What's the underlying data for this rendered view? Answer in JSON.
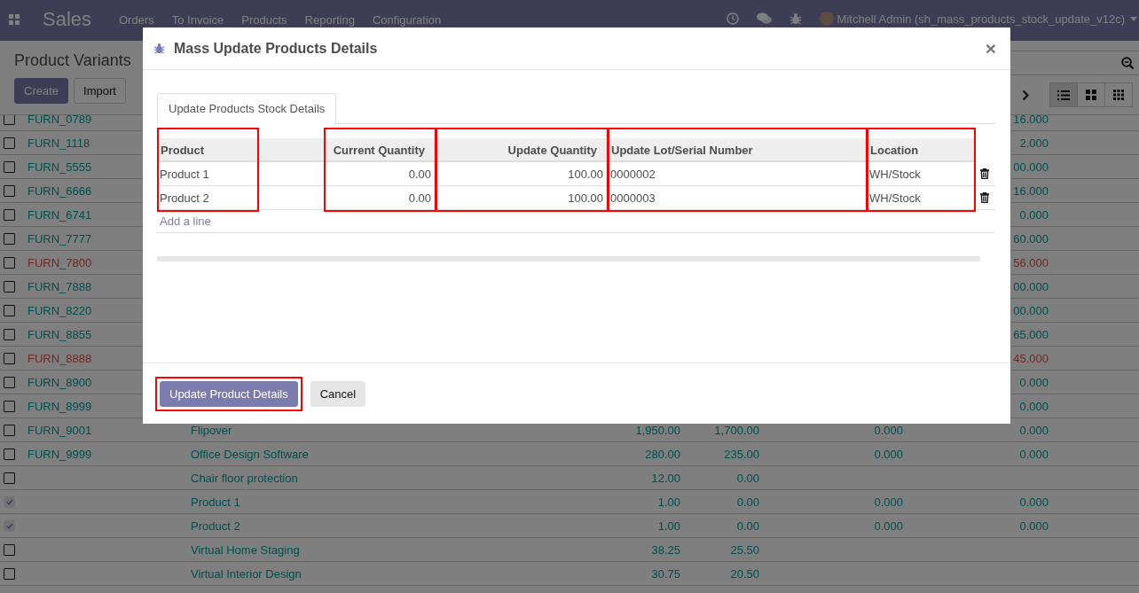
{
  "navbar": {
    "app_name": "Sales",
    "menu": [
      "Orders",
      "To Invoice",
      "Products",
      "Reporting",
      "Configuration"
    ],
    "user": "Mitchell Admin (sh_mass_products_stock_update_v12c)"
  },
  "control_panel": {
    "title": "Product Variants",
    "buttons": [
      {
        "label": "Create",
        "kind": "primary"
      },
      {
        "label": "Import",
        "kind": "secondary"
      }
    ],
    "views": [
      {
        "kind": "list",
        "selected": true
      },
      {
        "kind": "kanban",
        "selected": false
      },
      {
        "kind": "grid",
        "selected": false
      }
    ]
  },
  "list_rows": [
    {
      "checked": false,
      "warning": false,
      "column_1": "FURN_0789",
      "column_6": "16.000"
    },
    {
      "checked": false,
      "warning": false,
      "column_1": "FURN_1118",
      "column_6": "2.000"
    },
    {
      "checked": false,
      "warning": false,
      "column_1": "FURN_5555",
      "column_6": "00.000"
    },
    {
      "checked": false,
      "warning": false,
      "column_1": "FURN_6666",
      "column_6": "16.000"
    },
    {
      "checked": false,
      "warning": false,
      "column_1": "FURN_6741",
      "column_6": "0.000"
    },
    {
      "checked": false,
      "warning": false,
      "column_1": "FURN_7777",
      "column_6": "60.000"
    },
    {
      "checked": false,
      "warning": true,
      "column_1": "FURN_7800",
      "column_6": "56.000"
    },
    {
      "checked": false,
      "warning": false,
      "column_1": "FURN_7888",
      "column_6": "00.000"
    },
    {
      "checked": false,
      "warning": false,
      "column_1": "FURN_8220",
      "column_6": "00.000"
    },
    {
      "checked": false,
      "warning": false,
      "column_1": "FURN_8855",
      "column_6": "65.000"
    },
    {
      "checked": false,
      "warning": true,
      "column_1": "FURN_8888",
      "column_6": "45.000"
    },
    {
      "checked": false,
      "warning": false,
      "column_1": "FURN_8900",
      "column_6": "0.000"
    },
    {
      "checked": false,
      "warning": false,
      "column_1": "FURN_8999",
      "column_6": "0.000"
    },
    {
      "checked": false,
      "warning": false,
      "column_1": "FURN_9001",
      "column_2": "Flipover",
      "column_3": "1,950.00",
      "column_4": "1,700.00",
      "column_5": "0.000",
      "column_6": "0.000"
    },
    {
      "checked": false,
      "warning": false,
      "column_1": "FURN_9999",
      "column_2": "Office Design Software",
      "column_3": "280.00",
      "column_4": "235.00",
      "column_5": "0.000",
      "column_6": "0.000"
    },
    {
      "checked": false,
      "warning": false,
      "column_2": "Chair floor protection",
      "column_3": "12.00",
      "column_4": "0.00"
    },
    {
      "checked": true,
      "warning": false,
      "column_2": "Product 1",
      "column_3": "1.00",
      "column_4": "0.00",
      "column_5": "0.000",
      "column_6": "0.000"
    },
    {
      "checked": true,
      "warning": false,
      "column_2": "Product 2",
      "column_3": "1.00",
      "column_4": "0.00",
      "column_5": "0.000",
      "column_6": "0.000"
    },
    {
      "checked": false,
      "warning": false,
      "column_2": "Virtual Home Staging",
      "column_3": "38.25",
      "column_4": "25.50"
    },
    {
      "checked": false,
      "warning": false,
      "column_2": "Virtual Interior Design",
      "column_3": "30.75",
      "column_4": "20.50"
    }
  ],
  "dialog": {
    "title": "Mass Update Products Details",
    "close": "×",
    "tabs": [
      {
        "label": "Update Products Stock Details",
        "selected": true
      }
    ],
    "table": {
      "columns": [
        {
          "label": "Product",
          "kind": "text",
          "highlighted": true
        },
        {
          "label": "Current Quantity",
          "kind": "number",
          "highlighted": true
        },
        {
          "label": "Update Quantity",
          "kind": "number",
          "highlighted": true
        },
        {
          "label": "Update Lot/Serial Number",
          "kind": "text",
          "highlighted": true
        },
        {
          "label": "Location",
          "kind": "text",
          "highlighted": true
        }
      ],
      "rows": [
        {
          "cells": [
            "Product 1",
            "0.00",
            "100.00",
            "0000002",
            "WH/Stock"
          ]
        },
        {
          "cells": [
            "Product 2",
            "0.00",
            "100.00",
            "0000003",
            "WH/Stock"
          ]
        }
      ],
      "add_line": "Add a line"
    },
    "buttons": [
      {
        "label": "Update Product Details",
        "kind": "primary",
        "highlighted": true
      },
      {
        "label": "Cancel",
        "kind": "secondary",
        "highlighted": false
      }
    ]
  }
}
